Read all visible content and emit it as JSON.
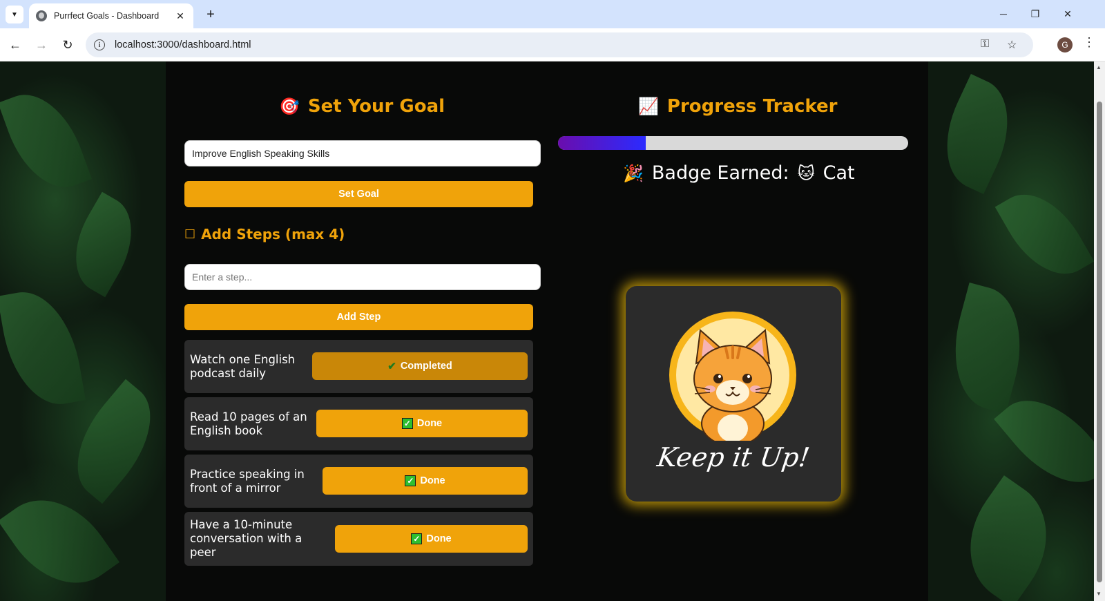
{
  "browser": {
    "tab_title": "Purrfect Goals - Dashboard",
    "url": "localhost:3000/dashboard.html",
    "profile_initial": "G"
  },
  "goal_section": {
    "heading": "Set Your Goal",
    "heading_icon": "🎯",
    "goal_input_value": "Improve English Speaking Skills",
    "set_goal_label": "Set Goal",
    "steps_heading": "Add Steps (max 4)",
    "steps_heading_icon": "☐",
    "step_input_placeholder": "Enter a step...",
    "add_step_label": "Add Step",
    "steps": [
      {
        "text": "Watch one English podcast daily",
        "status": "Completed"
      },
      {
        "text": "Read 10 pages of an English book",
        "status": "Done"
      },
      {
        "text": "Practice speaking in front of a mirror",
        "status": "Done"
      },
      {
        "text": "Have a 10-minute conversation with a peer",
        "status": "Done"
      }
    ]
  },
  "progress_section": {
    "heading": "Progress Tracker",
    "heading_icon": "📈",
    "progress_fraction": 0.25,
    "progress_colors": [
      "#6a0dad",
      "#2b2bff"
    ],
    "badge_prefix_icon": "🎉",
    "badge_label": "Badge Earned:",
    "badge_icon": "🐱",
    "badge_name": "Cat",
    "badge_card_caption": "Keep it Up!"
  },
  "colors": {
    "accent": "#f0a30a",
    "completed_button": "#c98708",
    "card_background": "#2b2b2b",
    "badge_glow": "#f0be0a"
  }
}
